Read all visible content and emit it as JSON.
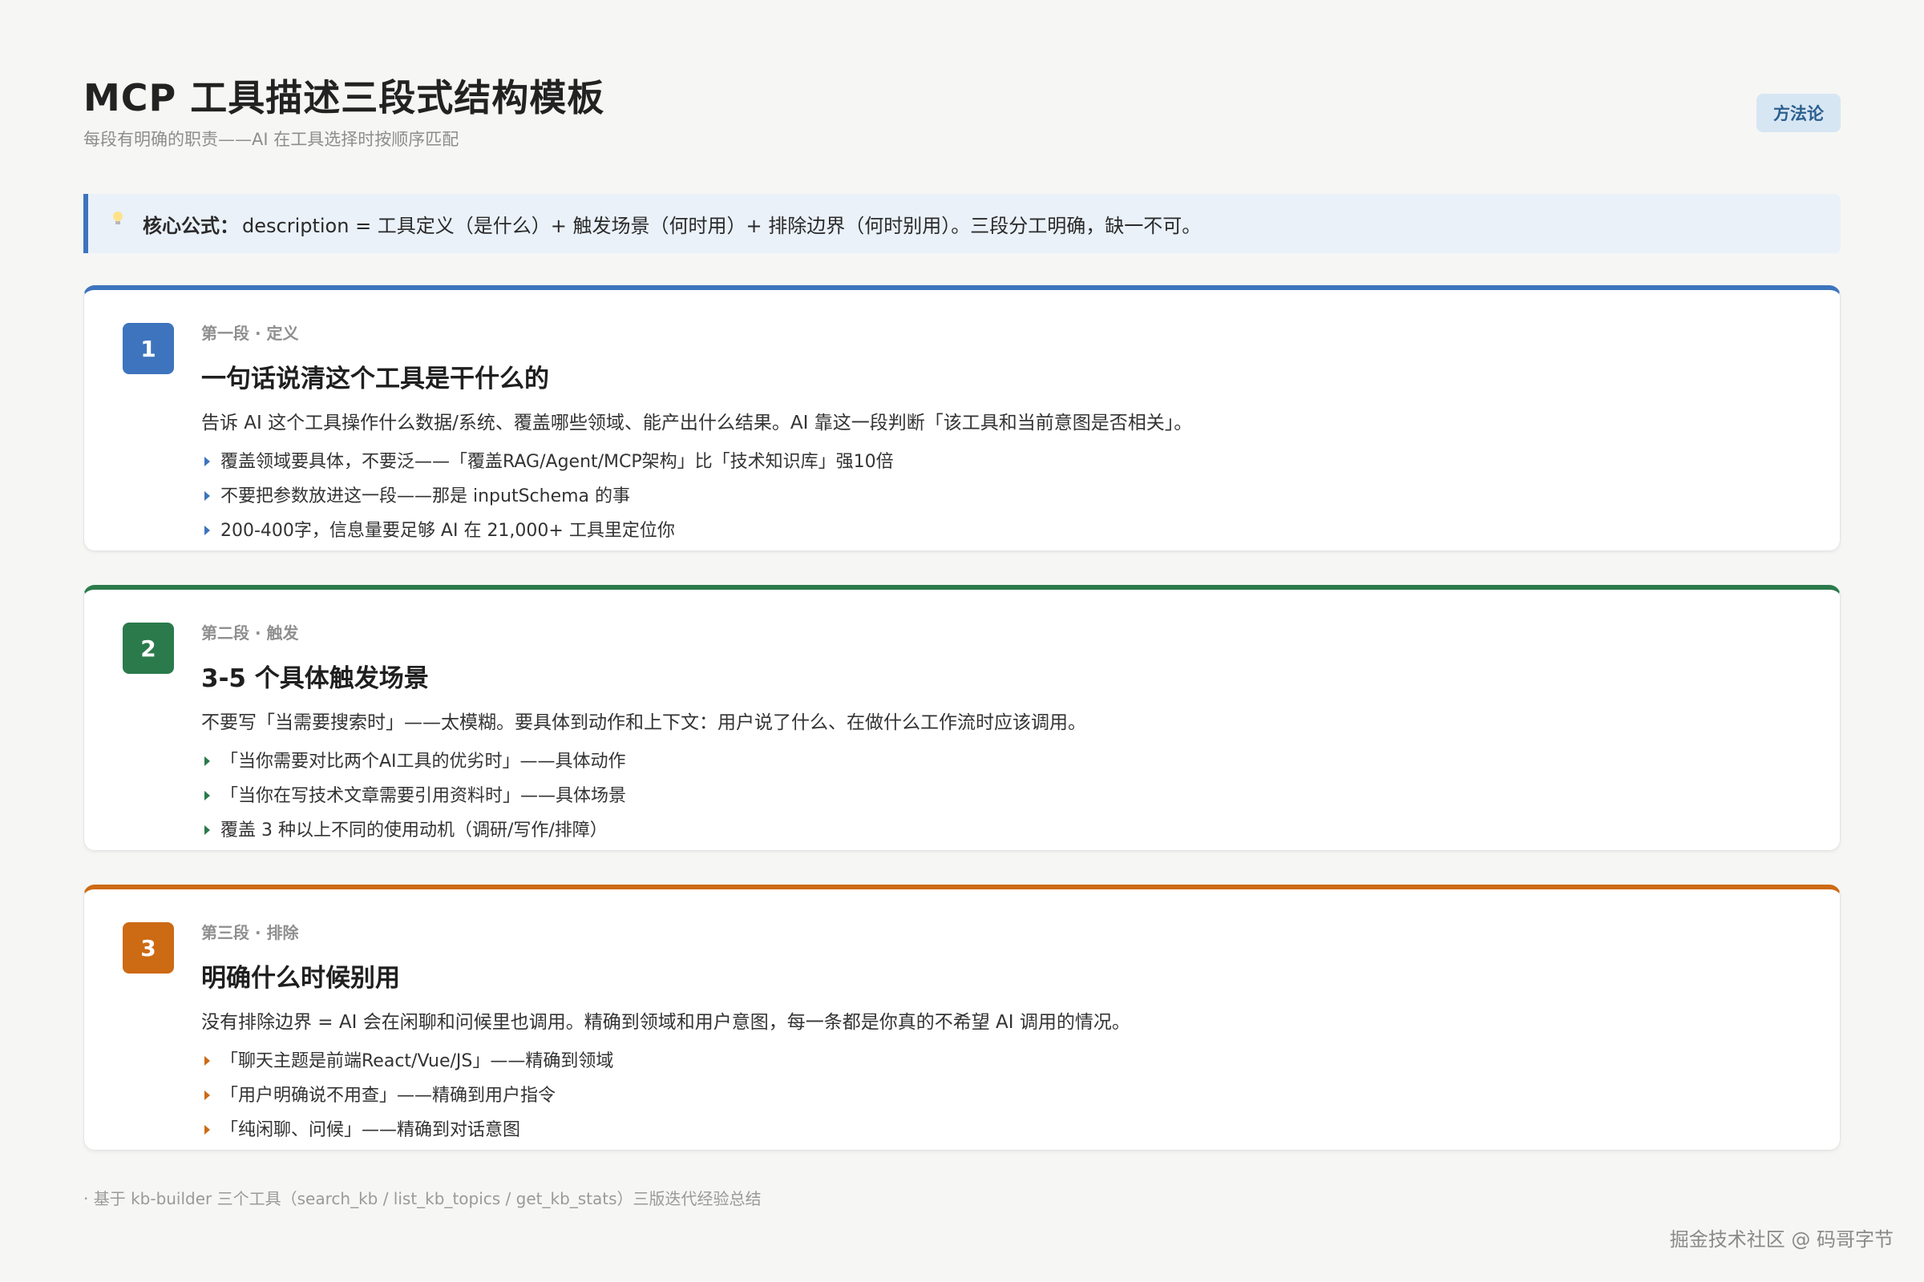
{
  "header": {
    "title": "MCP 工具描述三段式结构模板",
    "subtitle": "每段有明确的职责——AI 在工具选择时按顺序匹配",
    "badge": "方法论"
  },
  "formula": {
    "icon": "lightbulb-icon",
    "label": "核心公式：",
    "text": "description = 工具定义（是什么）+ 触发场景（何时用）+ 排除边界（何时别用）。三段分工明确，缺一不可。"
  },
  "colors": {
    "blue": "#3d74bd",
    "green": "#2b7a4b",
    "orange": "#cd6a14"
  },
  "sections": [
    {
      "number": "1",
      "kicker": "第一段 · 定义",
      "heading": "一句话说清这个工具是干什么的",
      "description": "告诉 AI 这个工具操作什么数据/系统、覆盖哪些领域、能产出什么结果。AI 靠这一段判断「该工具和当前意图是否相关」。",
      "bullets": [
        "覆盖领域要具体，不要泛——「覆盖RAG/Agent/MCP架构」比「技术知识库」强10倍",
        "不要把参数放进这一段——那是 inputSchema 的事",
        "200-400字，信息量要足够 AI 在 21,000+ 工具里定位你"
      ]
    },
    {
      "number": "2",
      "kicker": "第二段 · 触发",
      "heading": "3-5 个具体触发场景",
      "description": "不要写「当需要搜索时」——太模糊。要具体到动作和上下文：用户说了什么、在做什么工作流时应该调用。",
      "bullets": [
        "「当你需要对比两个AI工具的优劣时」——具体动作",
        "「当你在写技术文章需要引用资料时」——具体场景",
        "覆盖 3 种以上不同的使用动机（调研/写作/排障）"
      ]
    },
    {
      "number": "3",
      "kicker": "第三段 · 排除",
      "heading": "明确什么时候别用",
      "description": "没有排除边界 = AI 会在闲聊和问候里也调用。精确到领域和用户意图，每一条都是你真的不希望 AI 调用的情况。",
      "bullets": [
        "「聊天主题是前端React/Vue/JS」——精确到领域",
        "「用户明确说不用查」——精确到用户指令",
        "「纯闲聊、问候」——精确到对话意图"
      ]
    }
  ],
  "footnote": "· 基于 kb-builder 三个工具（search_kb / list_kb_topics / get_kb_stats）三版迭代经验总结",
  "watermark": "掘金技术社区 @ 码哥字节"
}
